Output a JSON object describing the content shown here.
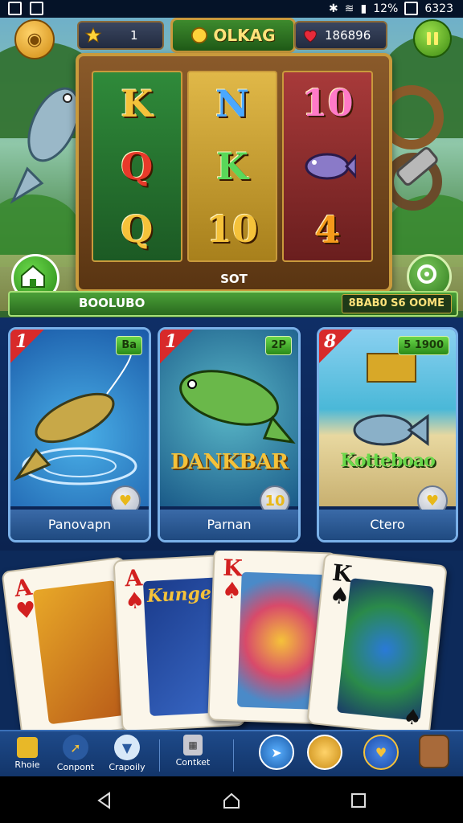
{
  "status_bar": {
    "battery": "12%",
    "time": "6323"
  },
  "hud": {
    "stars_value": "1",
    "title": "OLKAG",
    "hearts_value": "186896"
  },
  "slot": {
    "reels": [
      [
        "K",
        "Q",
        "Q"
      ],
      [
        "N",
        "K",
        "10"
      ],
      [
        "10",
        "fish",
        "4"
      ]
    ],
    "label": "SOT"
  },
  "info_bar": {
    "left_text": "BOOLUBO",
    "right_text": "8BAB0 S6 OOME"
  },
  "game_cards": [
    {
      "rank": "1",
      "badge": "Ba",
      "big_text": "",
      "name": "Panovapn",
      "heart_value": ""
    },
    {
      "rank": "1",
      "badge": "2P",
      "big_text": "DANKBAR",
      "name": "Parnan",
      "heart_value": "10"
    },
    {
      "rank": "8",
      "badge": "5 1900",
      "big_text": "Kotteboao",
      "name": "Ctero",
      "heart_value": ""
    }
  ],
  "playing_cards": [
    {
      "rank": "A",
      "suit": "♥",
      "color": "red"
    },
    {
      "rank": "A",
      "suit": "♠",
      "color": "red",
      "overlay": "Kunge"
    },
    {
      "rank": "K",
      "suit": "♠",
      "color": "red"
    },
    {
      "rank": "K",
      "suit": "♠",
      "color": "black"
    }
  ],
  "bottom_nav": [
    {
      "label": "Rhoie",
      "icon": "chest-icon"
    },
    {
      "label": "Conpont",
      "icon": "fishing-rod-icon"
    },
    {
      "label": "Crapoily",
      "icon": "cup-icon"
    },
    {
      "label": "Contket",
      "icon": "calculator-icon"
    },
    {
      "label": "",
      "icon": "compass-icon"
    },
    {
      "label": "",
      "icon": "coin-icon"
    },
    {
      "label": "",
      "icon": "heart-badge-icon"
    },
    {
      "label": "",
      "icon": "bag-icon"
    }
  ],
  "colors": {
    "accent_gold": "#c99a3c",
    "green_ui": "#3d8a2d",
    "nav_blue": "#1e4a8a",
    "card_red": "#d22020"
  }
}
